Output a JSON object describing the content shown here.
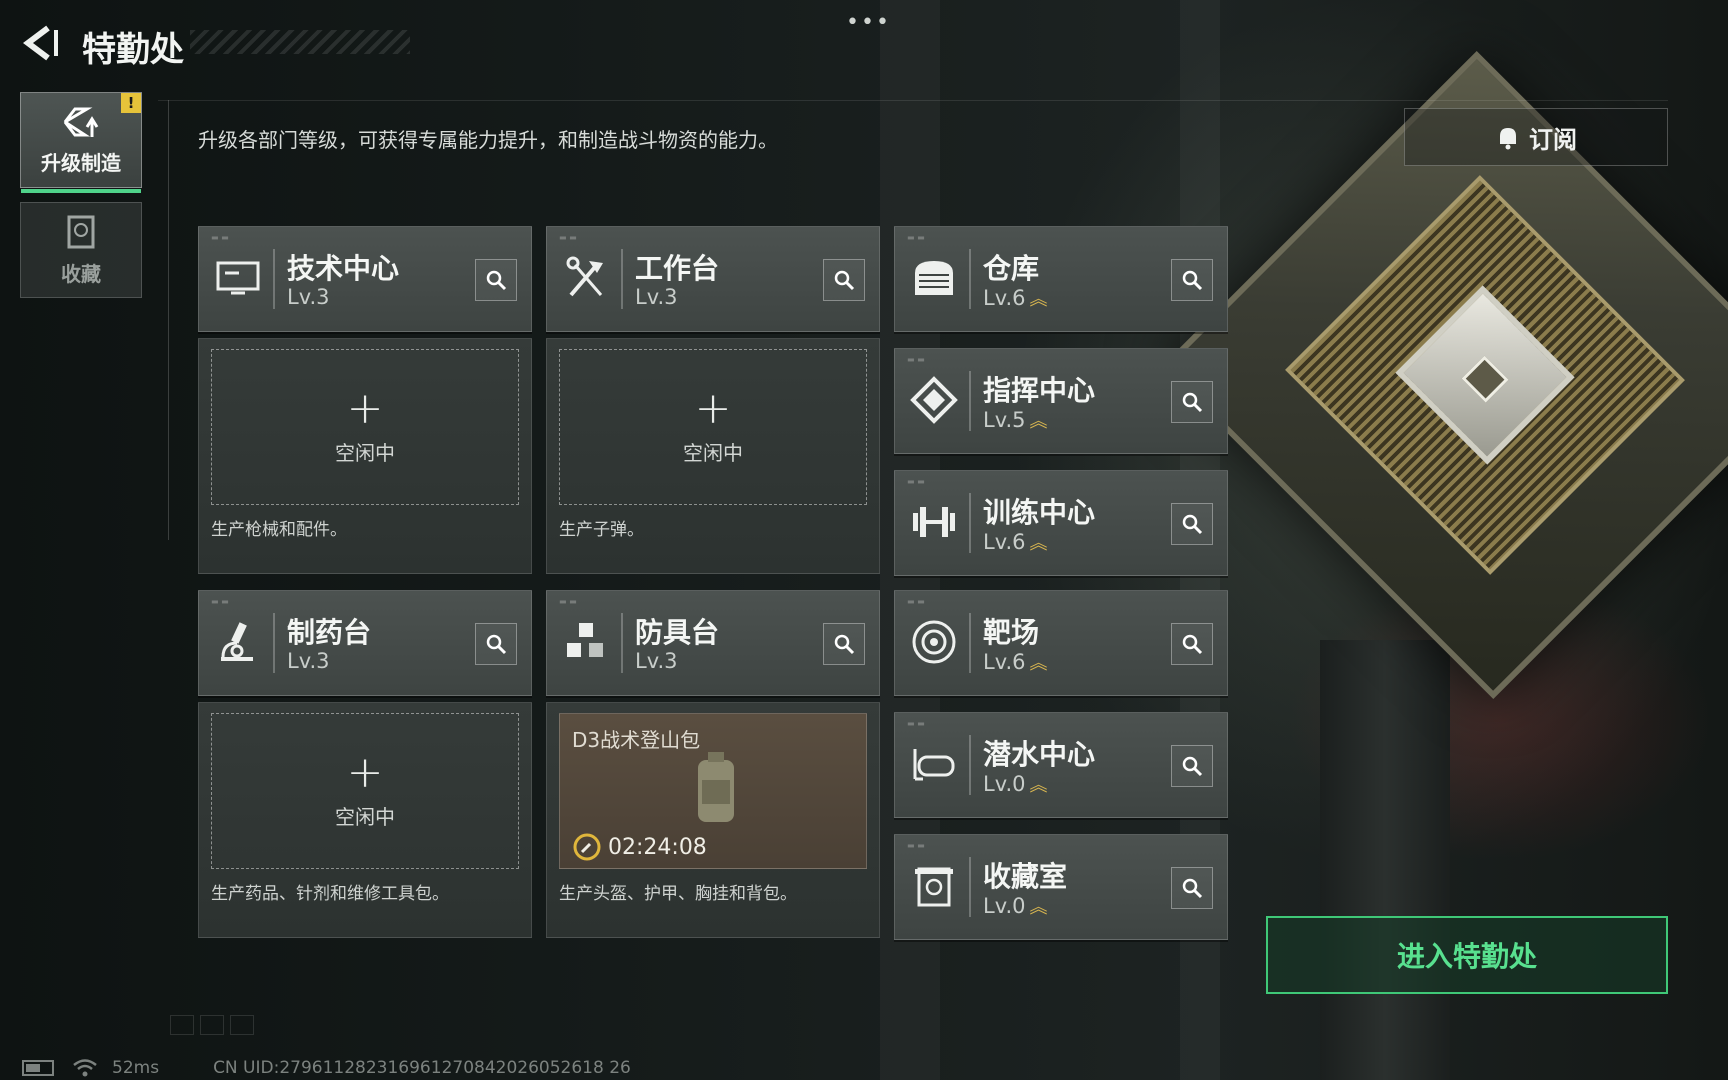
{
  "header": {
    "title": "特勤处",
    "description": "升级各部门等级，可获得专属能力提升，和制造战斗物资的能力。"
  },
  "side_tabs": [
    {
      "label": "升级制造",
      "icon": "upgrade-icon",
      "active": true,
      "badge": "!"
    },
    {
      "label": "收藏",
      "icon": "collection-icon",
      "active": false
    }
  ],
  "subscribe": {
    "label": "订阅",
    "icon": "bell-icon"
  },
  "workshops": [
    {
      "name": "技术中心",
      "level": "Lv.3",
      "icon": "computer-icon",
      "slot": {
        "state": "idle",
        "plus": "+",
        "label": "空闲中"
      },
      "produces": "生产枪械和配件。"
    },
    {
      "name": "工作台",
      "level": "Lv.3",
      "icon": "tools-icon",
      "slot": {
        "state": "idle",
        "plus": "+",
        "label": "空闲中"
      },
      "produces": "生产子弹。"
    },
    {
      "name": "制药台",
      "level": "Lv.3",
      "icon": "microscope-icon",
      "slot": {
        "state": "idle",
        "plus": "+",
        "label": "空闲中"
      },
      "produces": "生产药品、针剂和维修工具包。"
    },
    {
      "name": "防具台",
      "level": "Lv.3",
      "icon": "cubes-icon",
      "slot": {
        "state": "crafting",
        "item": "D3战术登山包",
        "timer": "02:24:08"
      },
      "produces": "生产头盔、护甲、胸挂和背包。"
    }
  ],
  "departments": [
    {
      "name": "仓库",
      "level": "Lv.6",
      "icon": "warehouse-icon",
      "upgradable": true
    },
    {
      "name": "指挥中心",
      "level": "Lv.5",
      "icon": "command-icon",
      "upgradable": true
    },
    {
      "name": "训练中心",
      "level": "Lv.6",
      "icon": "dumbbell-icon",
      "upgradable": true
    },
    {
      "name": "靶场",
      "level": "Lv.6",
      "icon": "target-icon",
      "upgradable": true
    },
    {
      "name": "潜水中心",
      "level": "Lv.0",
      "icon": "diving-mask-icon",
      "upgradable": true
    },
    {
      "name": "收藏室",
      "level": "Lv.0",
      "icon": "collection-room-icon",
      "upgradable": true
    }
  ],
  "upgrade_glyph": "︽",
  "enter_button": "进入特勤处",
  "status": {
    "ping": "52ms",
    "uid": "CN UID:279611282316961270842026052618 26"
  },
  "colors": {
    "accent_green": "#3fc877",
    "upgrade_gold": "#d8b650",
    "alert_yellow": "#e6c33a"
  }
}
